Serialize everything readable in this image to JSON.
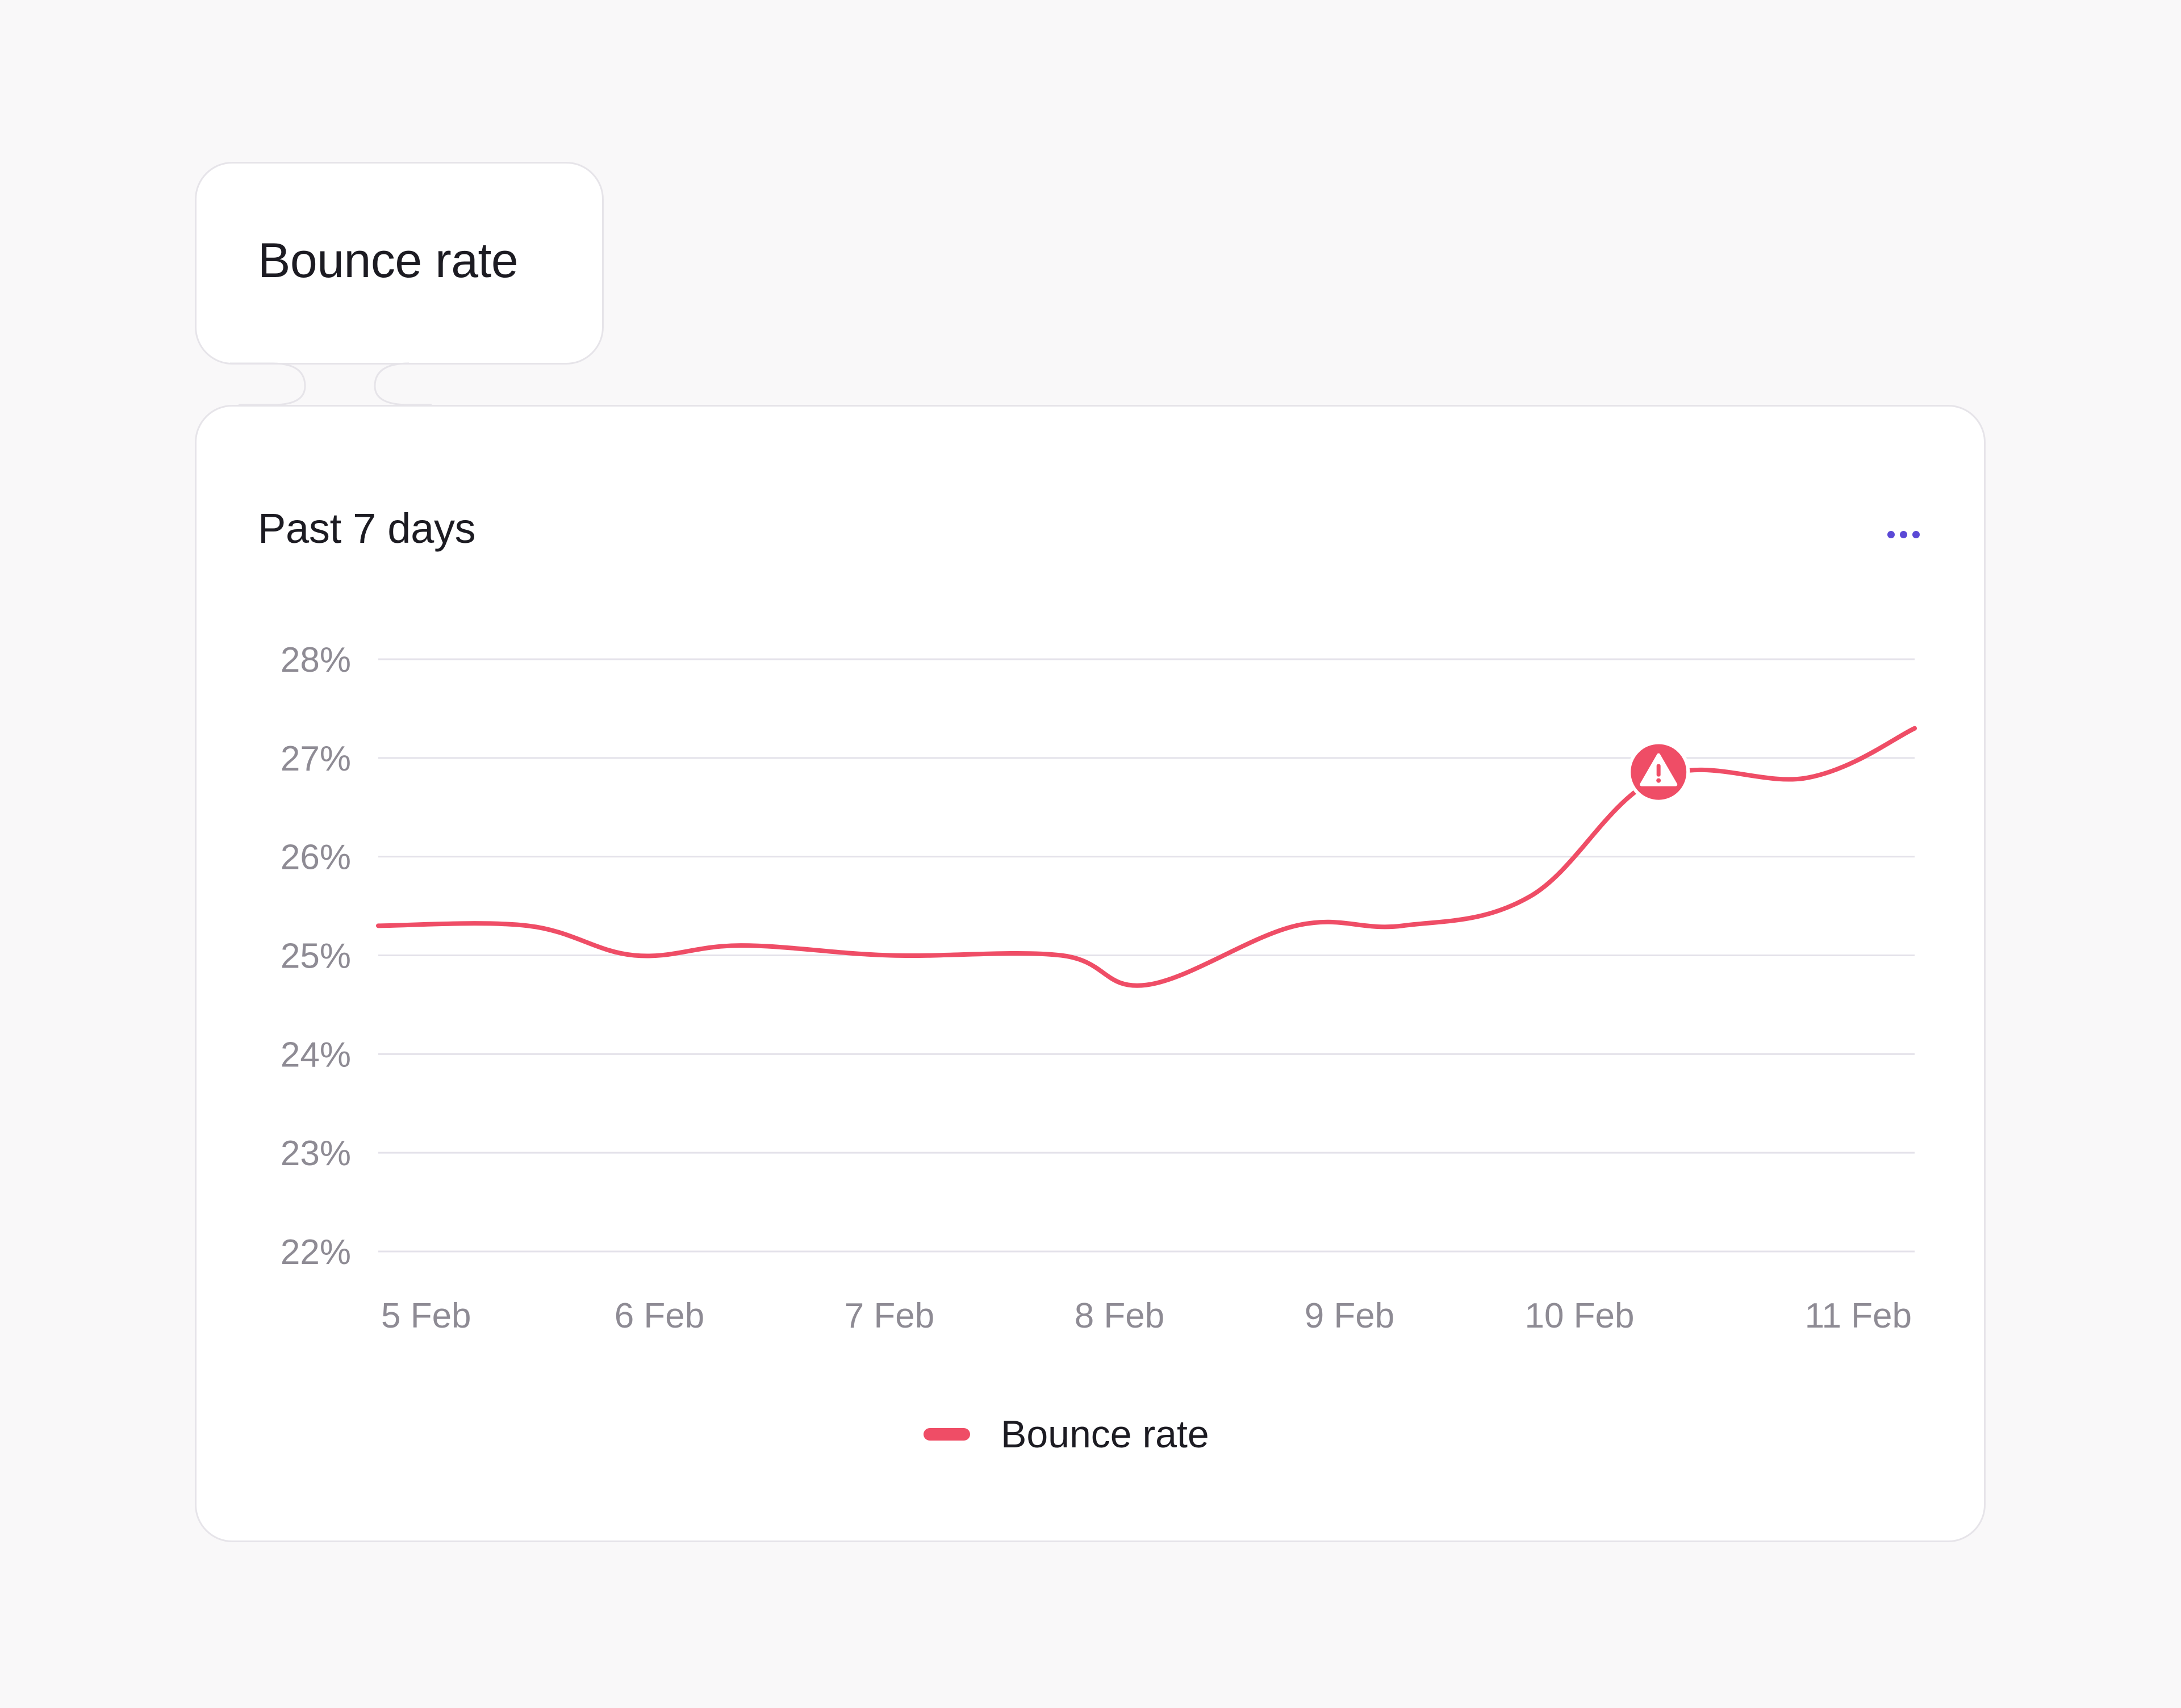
{
  "tab": {
    "title": "Bounce rate"
  },
  "card": {
    "subtitle": "Past 7 days",
    "menu_icon": "more-horizontal-icon"
  },
  "colors": {
    "series": "#ef4d66",
    "accent": "#5b49d6",
    "grid": "#e4e2ea"
  },
  "chart_data": {
    "type": "line",
    "title": "",
    "xlabel": "",
    "ylabel": "",
    "x_start": "5 Feb",
    "x_end": "11 Feb",
    "categories": [
      "5 Feb",
      "6 Feb",
      "7 Feb",
      "8 Feb",
      "9 Feb",
      "10 Feb",
      "11 Feb"
    ],
    "ylim": [
      22,
      28
    ],
    "y_ticks": [
      "28%",
      "27%",
      "26%",
      "25%",
      "24%",
      "23%",
      "22%"
    ],
    "grid": true,
    "legend_position": "bottom-center",
    "series": [
      {
        "name": "Bounce rate",
        "color": "#ef4d66",
        "points": [
          [
            "5 Feb",
            25.3
          ],
          [
            "5 Feb 14:00",
            25.3
          ],
          [
            "6 Feb",
            25.0
          ],
          [
            "6 Feb 10:00",
            25.1
          ],
          [
            "7 Feb",
            25.0
          ],
          [
            "7 Feb 16:00",
            25.0
          ],
          [
            "8 Feb",
            24.7
          ],
          [
            "8 Feb 14:00",
            25.3
          ],
          [
            "9 Feb",
            25.3
          ],
          [
            "9 Feb 12:00",
            25.6
          ],
          [
            "10 Feb",
            26.8
          ],
          [
            "10 Feb 14:00",
            26.8
          ],
          [
            "11 Feb",
            27.3
          ]
        ]
      }
    ],
    "annotations": [
      {
        "type": "warning",
        "x": "10 Feb",
        "y": 26.8,
        "icon": "warning-triangle-icon"
      }
    ]
  }
}
